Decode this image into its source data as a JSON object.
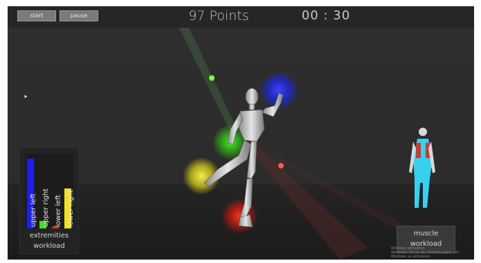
{
  "controls": {
    "start_label": "start",
    "pause_label": "pause"
  },
  "hud": {
    "points": "97 Points",
    "timer": "00 : 30"
  },
  "extremities": {
    "title_line1": "extremities",
    "title_line2": "workload",
    "bars": [
      {
        "label": "upper left",
        "value": 0.95,
        "color": "#1f1fe6"
      },
      {
        "label": "upper right",
        "value": 0.1,
        "color": "#44dd22"
      },
      {
        "label": "lower left",
        "value": 0.03,
        "color": "#d22b1f"
      },
      {
        "label": "lower right",
        "value": 0.55,
        "color": "#f0e020"
      }
    ]
  },
  "muscle": {
    "title_line1": "muscle",
    "title_line2": "workload"
  },
  "watermark": {
    "line1": "Windows aktivieren",
    "line2": "Wechseln Sie zu den Einstellungen, um Windows zu aktivieren."
  },
  "colors": {
    "hand_target": "#2633ff",
    "knee_target": "#3cd21e",
    "foot_left_target": "#f0f028",
    "foot_right_target": "#e02818",
    "ball_green": "#7dff3a",
    "ball_red": "#ff5a4a"
  }
}
